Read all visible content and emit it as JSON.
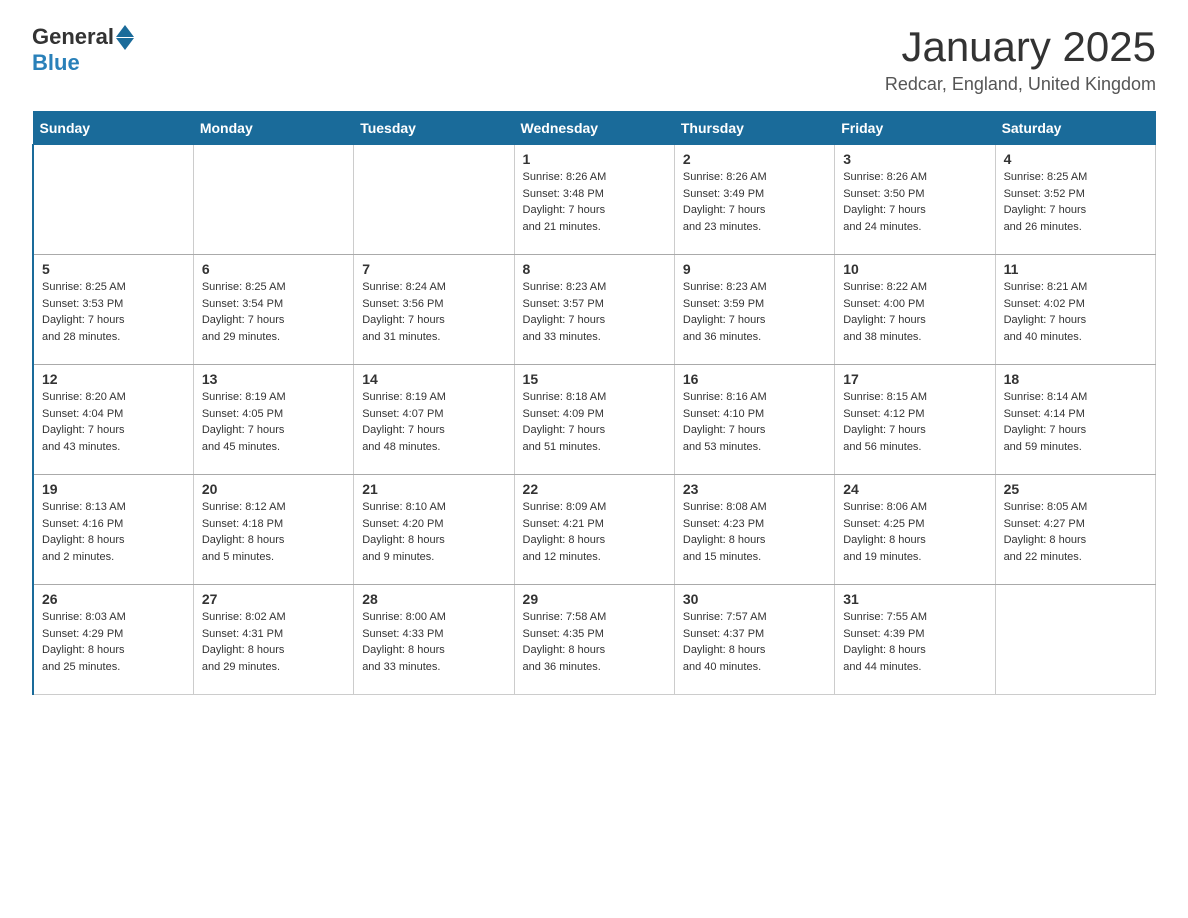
{
  "logo": {
    "text_general": "General",
    "text_blue": "Blue"
  },
  "header": {
    "title": "January 2025",
    "location": "Redcar, England, United Kingdom"
  },
  "days_of_week": [
    "Sunday",
    "Monday",
    "Tuesday",
    "Wednesday",
    "Thursday",
    "Friday",
    "Saturday"
  ],
  "weeks": [
    [
      {
        "day": "",
        "info": ""
      },
      {
        "day": "",
        "info": ""
      },
      {
        "day": "",
        "info": ""
      },
      {
        "day": "1",
        "info": "Sunrise: 8:26 AM\nSunset: 3:48 PM\nDaylight: 7 hours\nand 21 minutes."
      },
      {
        "day": "2",
        "info": "Sunrise: 8:26 AM\nSunset: 3:49 PM\nDaylight: 7 hours\nand 23 minutes."
      },
      {
        "day": "3",
        "info": "Sunrise: 8:26 AM\nSunset: 3:50 PM\nDaylight: 7 hours\nand 24 minutes."
      },
      {
        "day": "4",
        "info": "Sunrise: 8:25 AM\nSunset: 3:52 PM\nDaylight: 7 hours\nand 26 minutes."
      }
    ],
    [
      {
        "day": "5",
        "info": "Sunrise: 8:25 AM\nSunset: 3:53 PM\nDaylight: 7 hours\nand 28 minutes."
      },
      {
        "day": "6",
        "info": "Sunrise: 8:25 AM\nSunset: 3:54 PM\nDaylight: 7 hours\nand 29 minutes."
      },
      {
        "day": "7",
        "info": "Sunrise: 8:24 AM\nSunset: 3:56 PM\nDaylight: 7 hours\nand 31 minutes."
      },
      {
        "day": "8",
        "info": "Sunrise: 8:23 AM\nSunset: 3:57 PM\nDaylight: 7 hours\nand 33 minutes."
      },
      {
        "day": "9",
        "info": "Sunrise: 8:23 AM\nSunset: 3:59 PM\nDaylight: 7 hours\nand 36 minutes."
      },
      {
        "day": "10",
        "info": "Sunrise: 8:22 AM\nSunset: 4:00 PM\nDaylight: 7 hours\nand 38 minutes."
      },
      {
        "day": "11",
        "info": "Sunrise: 8:21 AM\nSunset: 4:02 PM\nDaylight: 7 hours\nand 40 minutes."
      }
    ],
    [
      {
        "day": "12",
        "info": "Sunrise: 8:20 AM\nSunset: 4:04 PM\nDaylight: 7 hours\nand 43 minutes."
      },
      {
        "day": "13",
        "info": "Sunrise: 8:19 AM\nSunset: 4:05 PM\nDaylight: 7 hours\nand 45 minutes."
      },
      {
        "day": "14",
        "info": "Sunrise: 8:19 AM\nSunset: 4:07 PM\nDaylight: 7 hours\nand 48 minutes."
      },
      {
        "day": "15",
        "info": "Sunrise: 8:18 AM\nSunset: 4:09 PM\nDaylight: 7 hours\nand 51 minutes."
      },
      {
        "day": "16",
        "info": "Sunrise: 8:16 AM\nSunset: 4:10 PM\nDaylight: 7 hours\nand 53 minutes."
      },
      {
        "day": "17",
        "info": "Sunrise: 8:15 AM\nSunset: 4:12 PM\nDaylight: 7 hours\nand 56 minutes."
      },
      {
        "day": "18",
        "info": "Sunrise: 8:14 AM\nSunset: 4:14 PM\nDaylight: 7 hours\nand 59 minutes."
      }
    ],
    [
      {
        "day": "19",
        "info": "Sunrise: 8:13 AM\nSunset: 4:16 PM\nDaylight: 8 hours\nand 2 minutes."
      },
      {
        "day": "20",
        "info": "Sunrise: 8:12 AM\nSunset: 4:18 PM\nDaylight: 8 hours\nand 5 minutes."
      },
      {
        "day": "21",
        "info": "Sunrise: 8:10 AM\nSunset: 4:20 PM\nDaylight: 8 hours\nand 9 minutes."
      },
      {
        "day": "22",
        "info": "Sunrise: 8:09 AM\nSunset: 4:21 PM\nDaylight: 8 hours\nand 12 minutes."
      },
      {
        "day": "23",
        "info": "Sunrise: 8:08 AM\nSunset: 4:23 PM\nDaylight: 8 hours\nand 15 minutes."
      },
      {
        "day": "24",
        "info": "Sunrise: 8:06 AM\nSunset: 4:25 PM\nDaylight: 8 hours\nand 19 minutes."
      },
      {
        "day": "25",
        "info": "Sunrise: 8:05 AM\nSunset: 4:27 PM\nDaylight: 8 hours\nand 22 minutes."
      }
    ],
    [
      {
        "day": "26",
        "info": "Sunrise: 8:03 AM\nSunset: 4:29 PM\nDaylight: 8 hours\nand 25 minutes."
      },
      {
        "day": "27",
        "info": "Sunrise: 8:02 AM\nSunset: 4:31 PM\nDaylight: 8 hours\nand 29 minutes."
      },
      {
        "day": "28",
        "info": "Sunrise: 8:00 AM\nSunset: 4:33 PM\nDaylight: 8 hours\nand 33 minutes."
      },
      {
        "day": "29",
        "info": "Sunrise: 7:58 AM\nSunset: 4:35 PM\nDaylight: 8 hours\nand 36 minutes."
      },
      {
        "day": "30",
        "info": "Sunrise: 7:57 AM\nSunset: 4:37 PM\nDaylight: 8 hours\nand 40 minutes."
      },
      {
        "day": "31",
        "info": "Sunrise: 7:55 AM\nSunset: 4:39 PM\nDaylight: 8 hours\nand 44 minutes."
      },
      {
        "day": "",
        "info": ""
      }
    ]
  ]
}
